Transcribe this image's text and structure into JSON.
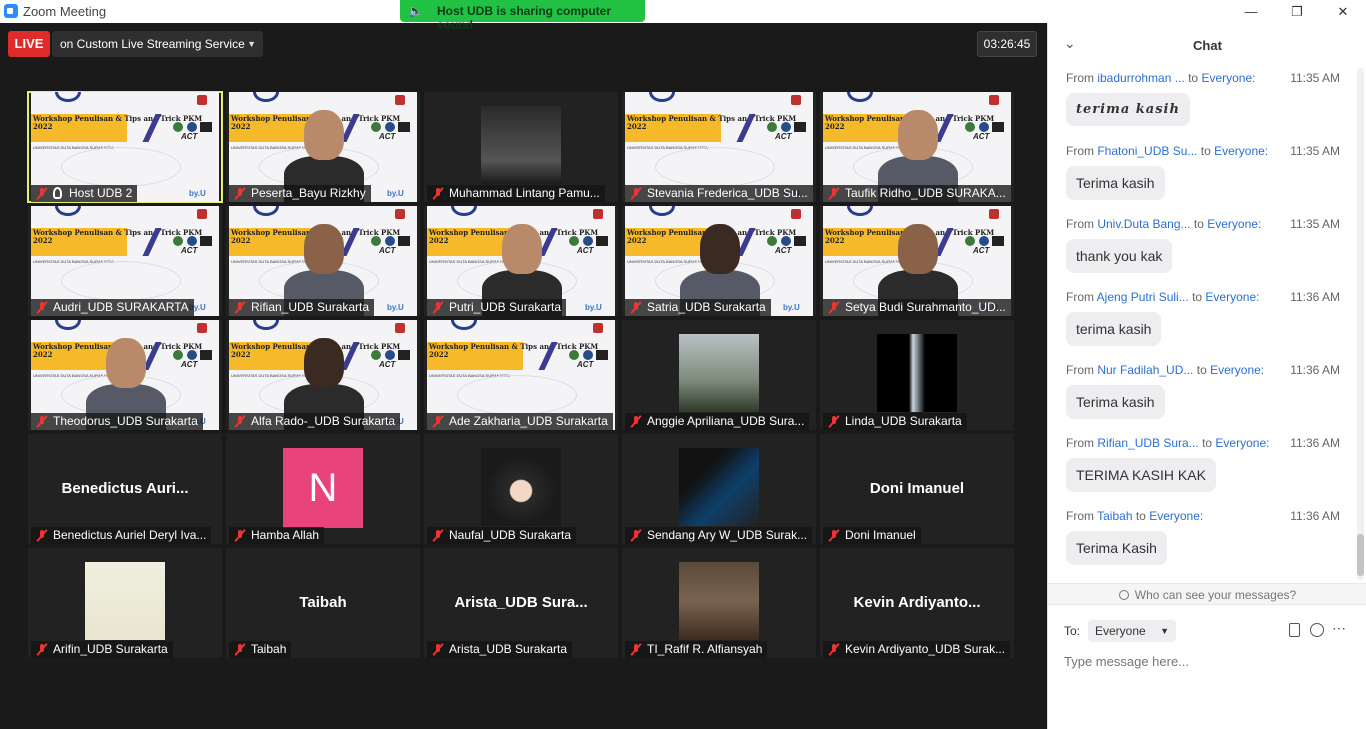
{
  "window": {
    "title": "Zoom Meeting",
    "min": "—",
    "max": "❐",
    "close": "✕"
  },
  "share_banner": {
    "icon": "speaker-icon",
    "text": "Host UDB is sharing computer sound"
  },
  "live": {
    "label": "LIVE",
    "service": "on Custom Live Streaming Service"
  },
  "timer": "03:26:45",
  "banner": {
    "headline": "Workshop Penulisan & Tips and Trick PKM 2022",
    "sub": "UNIVERSITAS DUTA BANGSA SURAKARTA",
    "act": "ACT",
    "byu": "by.U"
  },
  "participants": [
    {
      "name": "Host UDB 2",
      "kind": "banner",
      "active": true,
      "pin": true
    },
    {
      "name": "Peserta_Bayu Rizkhy",
      "kind": "banner-person"
    },
    {
      "name": "Muhammad Lintang Pamu...",
      "kind": "photo"
    },
    {
      "name": "Stevania Frederica_UDB Su...",
      "kind": "banner"
    },
    {
      "name": "Taufik Ridho_UDB SURAKA...",
      "kind": "banner-person"
    },
    {
      "name": "Audri_UDB SURAKARTA",
      "kind": "banner"
    },
    {
      "name": "Rifian_UDB Surakarta",
      "kind": "banner-person"
    },
    {
      "name": "Putri_UDB Surakarta",
      "kind": "banner-person"
    },
    {
      "name": "Satria_UDB Surakarta",
      "kind": "banner-person"
    },
    {
      "name": "Setya Budi Surahmanto_UD...",
      "kind": "banner-person"
    },
    {
      "name": "Theodorus_UDB Surakarta",
      "kind": "banner-person"
    },
    {
      "name": "Alfa Rado-_UDB Surakarta",
      "kind": "banner-person"
    },
    {
      "name": "Ade Zakharia_UDB Surakarta",
      "kind": "banner"
    },
    {
      "name": "Anggie Apriliana_UDB Sura...",
      "kind": "photo"
    },
    {
      "name": "Linda_UDB Surakarta",
      "kind": "photo"
    },
    {
      "name": "Benedictus Auriel Deryl Iva...",
      "kind": "text",
      "display": "Benedictus  Auri..."
    },
    {
      "name": "Hamba Allah",
      "kind": "avatar",
      "initial": "N"
    },
    {
      "name": "Naufal_UDB Surakarta",
      "kind": "photo"
    },
    {
      "name": "Sendang Ary W_UDB Surak...",
      "kind": "photo"
    },
    {
      "name": "Doni Imanuel",
      "kind": "text",
      "display": "Doni Imanuel"
    },
    {
      "name": "Arifin_UDB Surakarta",
      "kind": "photo"
    },
    {
      "name": "Taibah",
      "kind": "text",
      "display": "Taibah"
    },
    {
      "name": "Arista_UDB Surakarta",
      "kind": "text",
      "display": "Arista_UDB  Sura..."
    },
    {
      "name": "TI_Rafif R. Alfiansyah",
      "kind": "photo"
    },
    {
      "name": "Kevin Ardiyanto_UDB Surak...",
      "kind": "text",
      "display": "Kevin  Ardiyanto..."
    }
  ],
  "chat": {
    "title": "Chat",
    "messages": [
      {
        "from": "From",
        "sender": "ibadurrohman ...",
        "to": "to",
        "recipient": "Everyone:",
        "time": "11:35 AM",
        "text": "terima kasih"
      },
      {
        "from": "From",
        "sender": "Fhatoni_UDB Su...",
        "to": "to",
        "recipient": "Everyone:",
        "time": "11:35 AM",
        "text": "Terima kasih"
      },
      {
        "from": "From",
        "sender": "Univ.Duta Bang...",
        "to": "to",
        "recipient": "Everyone:",
        "time": "11:35 AM",
        "text": "thank you kak"
      },
      {
        "from": "From",
        "sender": "Ajeng Putri Suli...",
        "to": "to",
        "recipient": "Everyone:",
        "time": "11:36 AM",
        "text": "terima kasih"
      },
      {
        "from": "From",
        "sender": "Nur Fadilah_UD...",
        "to": "to",
        "recipient": "Everyone:",
        "time": "11:36 AM",
        "text": "Terima kasih"
      },
      {
        "from": "From",
        "sender": "Rifian_UDB Sura...",
        "to": "to",
        "recipient": "Everyone:",
        "time": "11:36 AM",
        "text": "TERIMA KASIH KAK"
      },
      {
        "from": "From",
        "sender": "Taibah",
        "to": "to",
        "recipient": "Everyone:",
        "time": "11:36 AM",
        "text": "Terima Kasih"
      }
    ],
    "who_can_see": "Who can see your messages?",
    "to_label": "To:",
    "to_value": "Everyone",
    "placeholder": "Type message here..."
  }
}
